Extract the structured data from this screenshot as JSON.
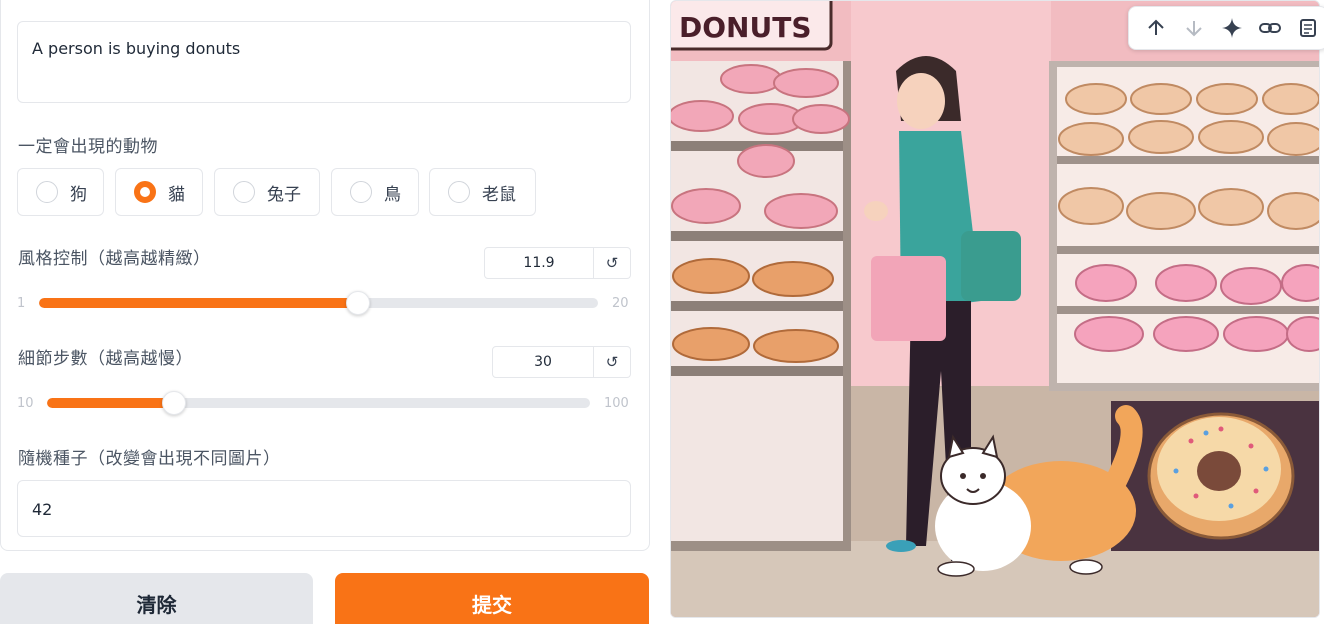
{
  "prompt": {
    "value": "A person is  buying donuts"
  },
  "animal": {
    "label": "一定會出現的動物",
    "options": [
      "狗",
      "貓",
      "兔子",
      "鳥",
      "老鼠"
    ],
    "selected": "貓"
  },
  "style_control": {
    "label": "風格控制（越高越精緻）",
    "value": "11.9",
    "min": "1",
    "max": "20",
    "reset_icon": "↺"
  },
  "detail_steps": {
    "label": "細節步數（越高越慢）",
    "value": "30",
    "min": "10",
    "max": "100",
    "reset_icon": "↺"
  },
  "seed": {
    "label": "隨機種子（改變會出現不同圖片）",
    "value": "42"
  },
  "buttons": {
    "clear": "清除",
    "submit": "提交"
  },
  "image": {
    "sign_text": "DONUTS"
  },
  "toolbar": {
    "icons": [
      "arrow-up-icon",
      "arrow-down-icon",
      "sparkle-icon",
      "link-icon",
      "document-icon"
    ]
  },
  "colors": {
    "accent": "#f97316",
    "border": "#e5e7eb"
  }
}
